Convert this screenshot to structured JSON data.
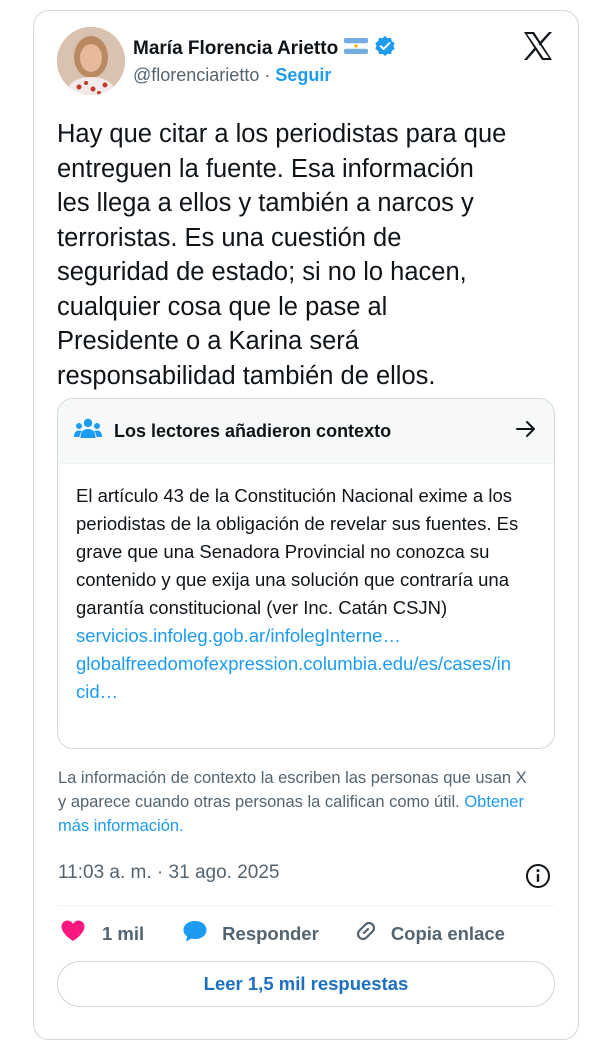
{
  "author": {
    "name": "María Florencia Arietto",
    "handle": "@florenciarietto",
    "separator": "·",
    "follow_label": "Seguir"
  },
  "tweet": {
    "text": "Hay que citar a los periodistas para que\nentreguen la fuente. Esa información\nles llega a ellos y también a narcos y\nterroristas. Es una cuestión de\nseguridad de estado; si no lo hacen,\ncualquier cosa que le pase al\nPresidente o a Karina será\nresponsabilidad también de ellos.",
    "time": "11:03 a. m. · 31 ago. 2025"
  },
  "community_note": {
    "title": "Los lectores añadieron contexto",
    "body": "El artículo 43 de la Constitución Nacional exime a los periodistas de la obligación de revelar sus fuentes. Es grave que una Senadora Provincial no conozca su contenido y que exija una solución que contraría una garantía constitucional (ver Inc. Catán CSJN)",
    "link1": "servicios.infoleg.gob.ar/infolegInterne…",
    "link2": "globalfreedomofexpression.columbia.edu/es/cases/incid…"
  },
  "context_info": {
    "text": "La información de contexto la escriben las personas que usan X y aparece cuando otras personas la califican como útil.",
    "more_link": "Obtener más información."
  },
  "actions": {
    "likes": "1 mil",
    "reply_label": "Responder",
    "copy_link_label": "Copia enlace"
  },
  "read_replies_label": "Leer 1,5 mil respuestas",
  "colors": {
    "accent": "#1d9bf0",
    "like": "#f91880",
    "text": "#0f1419",
    "secondary": "#536471",
    "border": "#cfd9de"
  }
}
